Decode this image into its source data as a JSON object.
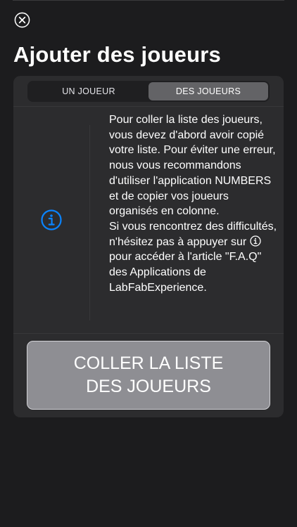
{
  "header": {
    "close_icon": "close-circle-icon",
    "title": "Ajouter des joueurs"
  },
  "segmented_control": {
    "options": [
      {
        "label": "UN JOUEUR",
        "selected": false
      },
      {
        "label": "DES JOUEURS",
        "selected": true
      }
    ]
  },
  "info": {
    "icon": "info-circle-icon",
    "accent_color": "#0a84ff",
    "paragraph_1": "Pour coller la liste des joueurs, vous devez d'abord avoir copié votre liste. Pour éviter une erreur, nous vous recommandons d'utiliser l'application NUMBERS et de copier vos joueurs organisés en colonne.",
    "paragraph_2_before": "Si vous rencontrez des difficultés, n'hésitez pas à appuyer sur",
    "paragraph_2_after": "pour accéder à l'article \"F.A.Q\" des Applications de LabFabExperience."
  },
  "paste_button": {
    "label": "COLLER LA LISTE\nDES JOUEURS"
  }
}
